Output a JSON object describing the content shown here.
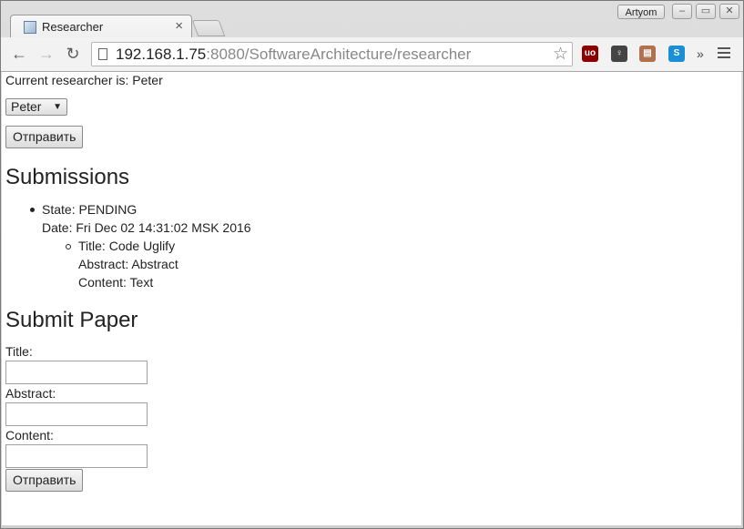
{
  "browser": {
    "tab_title": "Researcher",
    "profile_name": "Artyom",
    "url_host": "192.168.1.75",
    "url_rest": ":8080/SoftwareArchitecture/researcher",
    "more_extensions": "»"
  },
  "page": {
    "current_researcher_text": "Current researcher is: Peter",
    "researcher_select_value": "Peter",
    "select_submit_label": "Отправить",
    "submissions_heading": "Submissions",
    "submissions": [
      {
        "state": "State: PENDING",
        "date": "Date: Fri Dec 02 14:31:02 MSK 2016",
        "title": "Title: Code Uglify",
        "abstract": "Abstract: Abstract",
        "content": "Content: Text"
      }
    ],
    "submit_paper_heading": "Submit Paper",
    "title_label": "Title:",
    "abstract_label": "Abstract:",
    "content_label": "Content:",
    "title_value": "",
    "abstract_value": "",
    "content_value": "",
    "paper_submit_label": "Отправить"
  },
  "colors": {
    "ublock": "#8b0000",
    "skype": "#1a8fd6"
  }
}
